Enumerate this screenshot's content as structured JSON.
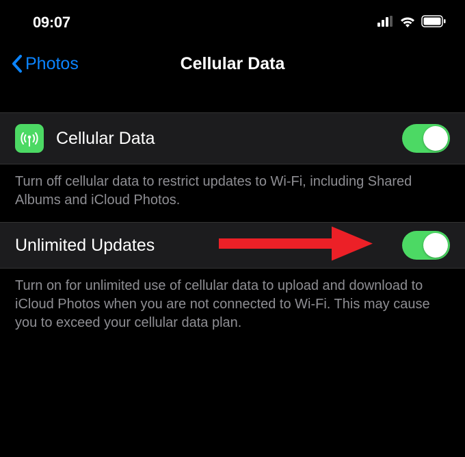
{
  "status": {
    "time": "09:07"
  },
  "nav": {
    "back_label": "Photos",
    "title": "Cellular Data"
  },
  "rows": {
    "cellular": {
      "label": "Cellular Data",
      "footer": "Turn off cellular data to restrict updates to Wi-Fi, including Shared Albums and iCloud Photos.",
      "on": true
    },
    "unlimited": {
      "label": "Unlimited Updates",
      "footer": "Turn on for unlimited use of cellular data to upload and download to iCloud Photos when you are not connected to Wi-Fi. This may cause you to exceed your cellular data plan.",
      "on": true
    }
  },
  "colors": {
    "accent_link": "#0b84ff",
    "switch_on": "#4cd964",
    "cell_bg": "#1c1c1e",
    "footer_text": "#8e8e93",
    "annotation_arrow": "#ec2027"
  }
}
